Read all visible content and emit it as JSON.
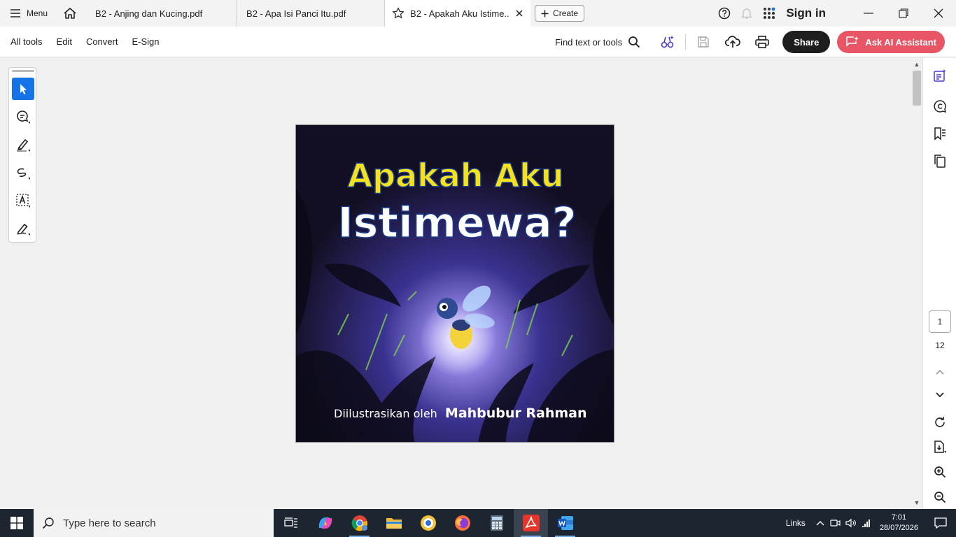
{
  "titlebar": {
    "menu_label": "Menu",
    "tabs": [
      {
        "label": "B2 - Anjing dan Kucing.pdf"
      },
      {
        "label": "B2 - Apa Isi Panci Itu.pdf"
      },
      {
        "label": "B2 - Apakah Aku Istime..."
      }
    ],
    "create_label": "Create",
    "signin_label": "Sign in"
  },
  "toolbar": {
    "menus": [
      "All tools",
      "Edit",
      "Convert",
      "E-Sign"
    ],
    "find_label": "Find text or tools",
    "share_label": "Share",
    "ask_ai_label": "Ask AI Assistant"
  },
  "document": {
    "cover_title_line1": "Apakah Aku",
    "cover_title_line2": "Istimewa?",
    "cover_credit_prefix": "Diilustrasikan oleh",
    "cover_credit_name": "Mahbubur  Rahman"
  },
  "page_nav": {
    "current_page": "1",
    "total_pages": "12"
  },
  "taskbar": {
    "search_placeholder": "Type here to search",
    "links_label": "Links",
    "time": "7:01",
    "date": "28/07/2026"
  },
  "colors": {
    "accent_blue": "#1473e6",
    "ask_ai": "#e85565",
    "cover_title_yellow": "#f5e21c",
    "taskbar": "#1d2530"
  }
}
